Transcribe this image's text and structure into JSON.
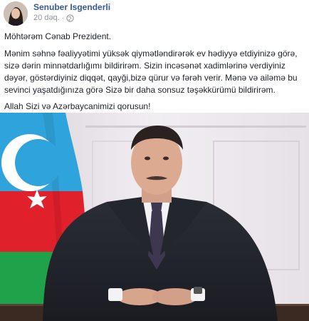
{
  "post": {
    "author": "Senuber Isgenderli",
    "time": "20 dəq.",
    "separator": "·",
    "privacy_icon": "globe-icon",
    "greeting": "Möhtərəm Cənab Prezident.",
    "body": "Mənim səhnə fəaliyyətimi yüksək qiymətləndirərək ev hədiyyə etdiyinizə görə, sizə dərin minnətdarlığımı bildirirəm. Sizin incəsənət xadimlərinə verdiyiniz dəyər, göstərdiyiniz diqqət, qayği,bizə qürur və fərəh verir. Mənə və ailəmə bu sevinci yaşatdığınıza görə Sizə bir daha sonsuz təşəkkürümü bildirirəm.",
    "closing": "Allah Sizi və Azərbaycanimizi qorusun!"
  },
  "colors": {
    "author_link": "#385898",
    "meta_text": "#90949c",
    "flag_blue": "#2fa4dc",
    "flag_red": "#e0202a",
    "flag_green": "#1ea34a"
  },
  "icons": {
    "avatar": "profile-photo",
    "photo": "official-portrait-photo"
  }
}
